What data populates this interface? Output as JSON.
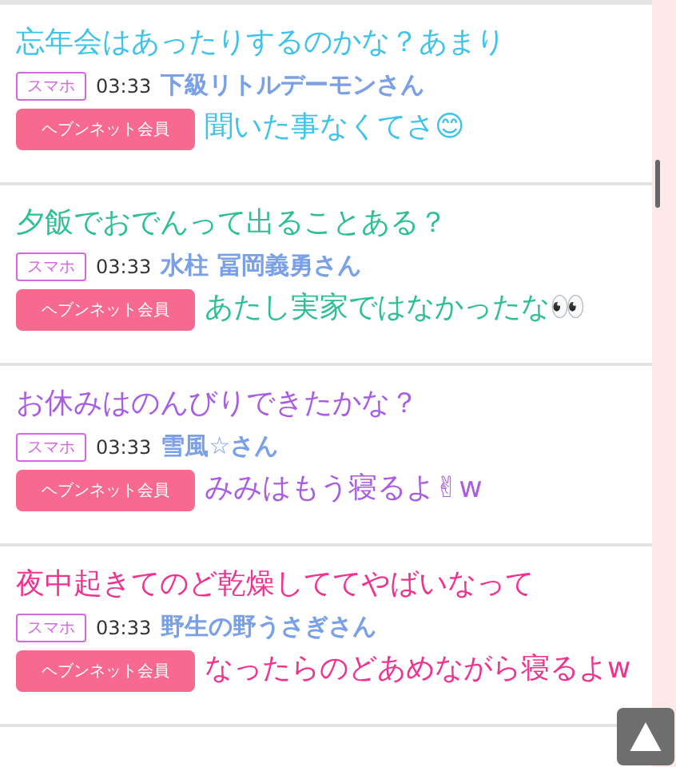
{
  "posts": [
    {
      "badge": "スマホ",
      "time": "03:33",
      "name": "下級リトルデーモンさん",
      "member_button": "ヘブンネット会員",
      "color": "#3fc3ea",
      "captions": [
        "忘年会はあったりするのかな？あまり",
        "聞いた事なくてさ😊"
      ]
    },
    {
      "badge": "スマホ",
      "time": "03:33",
      "name": "水柱 冨岡義勇さん",
      "member_button": "ヘブンネット会員",
      "color": "#2fbf96",
      "captions": [
        "夕飯でおでんって出ることある？",
        "あたし実家ではなかったな👀"
      ]
    },
    {
      "badge": "スマホ",
      "time": "03:33",
      "name": "雪風☆さん",
      "member_button": "ヘブンネット会員",
      "color": "#a95de0",
      "captions": [
        "お休みはのんびりできたかな？",
        "みみはもう寝るよ✌w"
      ]
    },
    {
      "badge": "スマホ",
      "time": "03:33",
      "name": "野生の野うさぎさん",
      "member_button": "ヘブンネット会員",
      "color": "#f0338f",
      "captions": [
        "夜中起きてのど乾燥しててやばいなって",
        "なったらのどあめながら寝るよw"
      ]
    }
  ]
}
